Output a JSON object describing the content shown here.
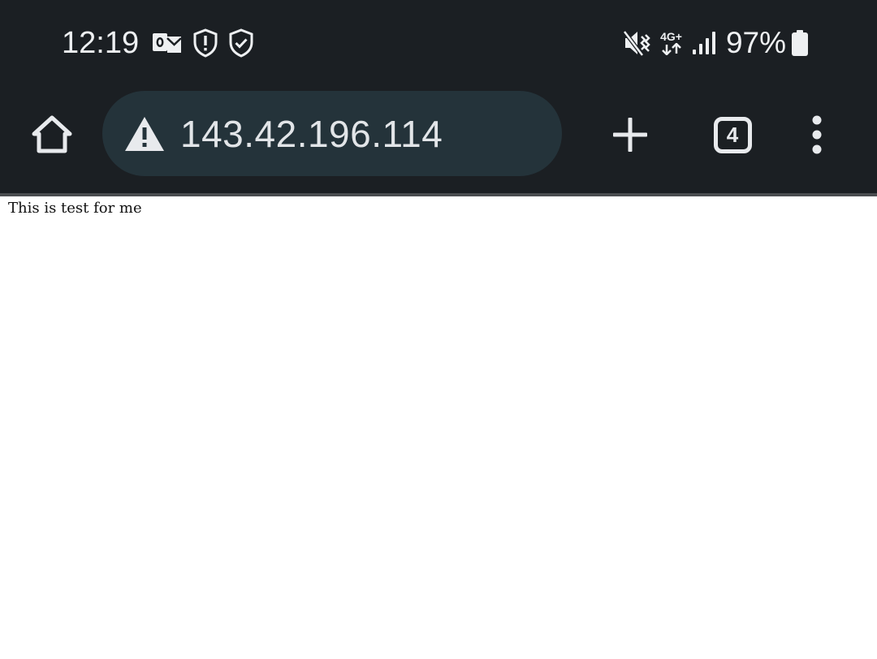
{
  "status_bar": {
    "time": "12:19",
    "left_icons": [
      "outlook-icon",
      "shield-alert-icon",
      "shield-check-icon"
    ],
    "right_icons": [
      "mute-vibrate-icon",
      "network-4g-plus-icon",
      "signal-icon",
      "battery-icon"
    ],
    "network_type": "4G+",
    "battery_percent": "97%"
  },
  "toolbar": {
    "url": "143.42.196.114",
    "security_icon": "warning-triangle-icon",
    "tab_count": "4"
  },
  "page": {
    "body_text": "This is test for me"
  },
  "colors": {
    "chrome_background": "#1b1f23",
    "omnibox_background": "#24333a",
    "foreground": "#e8eaed",
    "page_background": "#ffffff"
  }
}
